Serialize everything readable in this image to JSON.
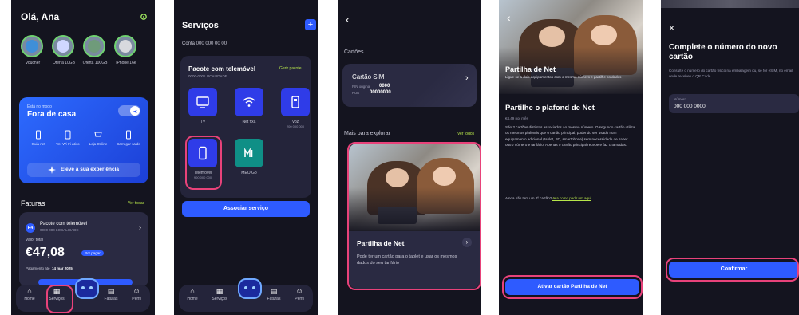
{
  "screen1": {
    "greeting": "Olá, Ana",
    "stories": [
      {
        "label": "Voucher"
      },
      {
        "label": "Oferta 10GB"
      },
      {
        "label": "Oferta 100GB"
      },
      {
        "label": "iPhone 16e"
      }
    ],
    "hero": {
      "mode_caption": "Está no modo",
      "mode": "Fora de casa",
      "actions": [
        "Guia net",
        "Ver Wi-Fi ativo",
        "Loja Online",
        "Carregar saldo"
      ],
      "cta": "Eleve a sua experiência"
    },
    "faturas": {
      "title": "Faturas",
      "see_all": "Ver todas",
      "badge": "R4",
      "plan": "Pacote com telemóvel",
      "plan_sub": "0000 000 LOCALIDADE",
      "total_label": "Valor total",
      "amount": "€47,08",
      "status": "Por pagar",
      "due_prefix": "Pagamento até",
      "due_date": "14 mar 2025"
    },
    "tabs": [
      "Home",
      "Serviços",
      "",
      "Faturas",
      "Perfil"
    ]
  },
  "screen2": {
    "title": "Serviços",
    "account": "Conta 000 000 00 00",
    "package": "Pacote com telemóvel",
    "package_sub": "0000-000 LOCALIDADE",
    "manage": "Gerir pacote",
    "services": [
      {
        "label": "TV",
        "sub": ""
      },
      {
        "label": "Net fixa",
        "sub": ""
      },
      {
        "label": "Voz",
        "sub": "200 000 000"
      },
      {
        "label": "Telemóvel",
        "sub": "900 000 000"
      },
      {
        "label": "MEO Go",
        "sub": ""
      }
    ],
    "associate": "Associar serviço",
    "tabs": [
      "Home",
      "Serviços",
      "",
      "Faturas",
      "Perfil"
    ]
  },
  "screen3": {
    "section": "Cartões",
    "sim_title": "Cartão SIM",
    "pin_label": "PIN original",
    "pin_value": "0000",
    "puk_label": "PUK",
    "puk_value": "00000000",
    "explore": "Mais para explorar",
    "see_all": "Ver todos",
    "offer_title": "Partilha de Net",
    "offer_desc": "Pode ter um cartão para o tablet e usar os mesmos dados do seu tarifário"
  },
  "screen4": {
    "hero_title": "Partilha de Net",
    "hero_sub": "Ligue-se a dois equipamentos com o mesmo número e partilhe os dados",
    "title": "Partilhe o plafond de Net",
    "price": "€4,49 por mês",
    "body": "São 2 cartões distintos associados ao mesmo número. O segundo cartão utiliza os mesmos plafonds que o cartão principal, podendo ser usado num equipamento adicional (tablet, PC, smartphone) sem necessidade de saber outro número e tarifário. Apenas o cartão principal recebe e faz chamadas.",
    "prompt": "Ainda não tem um 2º cartão?",
    "prompt_link": "Veja como pedir um aqui",
    "cta": "Ativar cartão Partilha de Net"
  },
  "screen5": {
    "title": "Complete o número do novo cartão",
    "hint": "Consulte o número do cartão físico na embalagem ou, se for eSIM, no email onde recebeu o QR Code.",
    "field_label": "Número",
    "field_value": "000 000 0000",
    "confirm": "Confirmar"
  },
  "colors": {
    "background": "#14141f",
    "card": "#24243a",
    "accent": "#2e5bff",
    "highlight": "#e8427a",
    "link": "#b7e64a"
  }
}
